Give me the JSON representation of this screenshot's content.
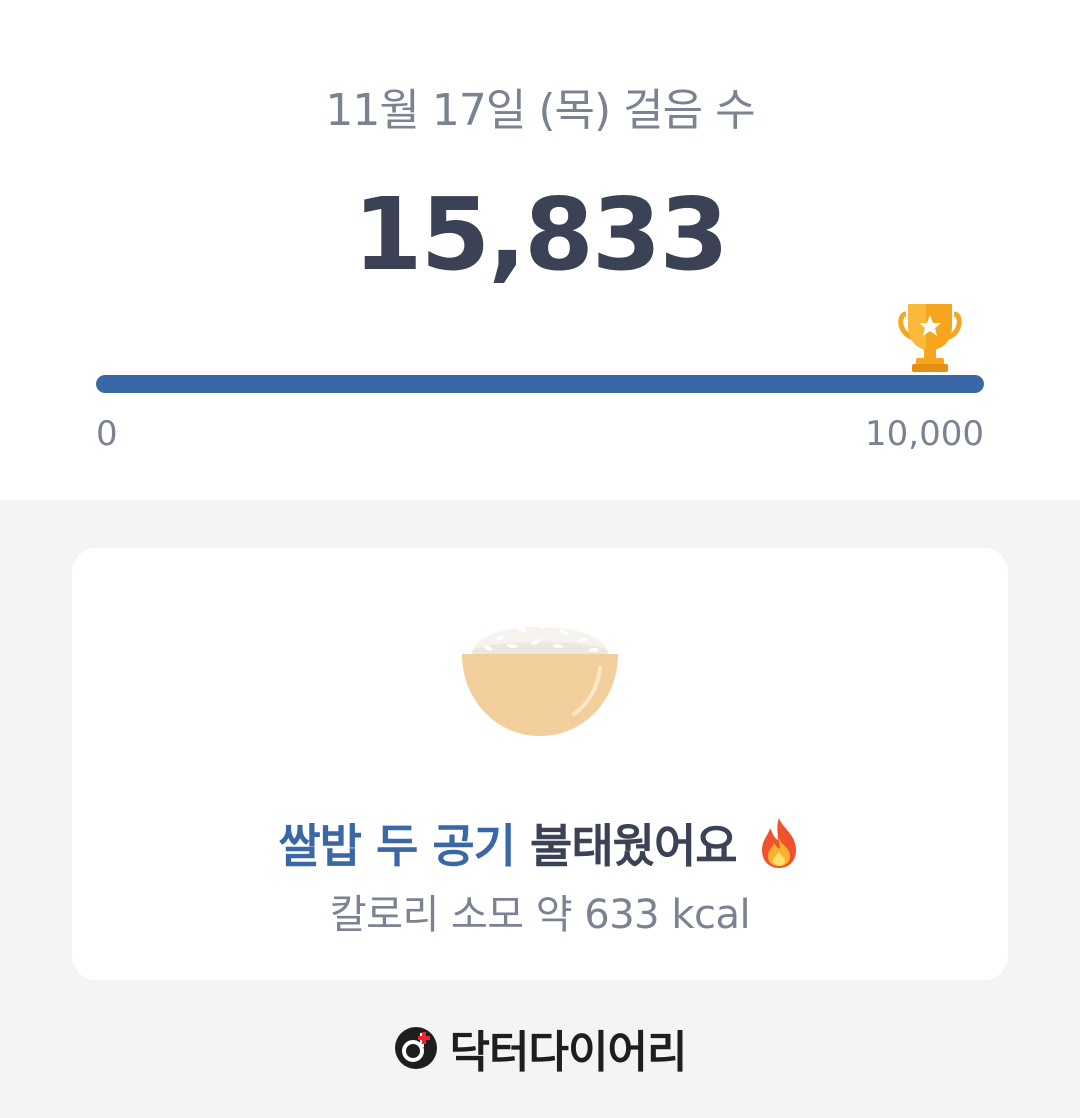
{
  "header": {
    "date_label": "11월 17일 (목) 걸음 수",
    "steps_count": "15,833"
  },
  "progress": {
    "min_label": "0",
    "max_label": "10,000",
    "current": 15833,
    "goal": 10000,
    "fill_fraction": 1.0,
    "goal_icon": "trophy-icon",
    "fill_color": "#3a67a6"
  },
  "summary_card": {
    "illustration_icon": "rice-bowl-icon",
    "headline_accent": "쌀밥 두 공기",
    "headline_rest": " 불태웠어요",
    "headline_icon": "fire-icon",
    "calorie_text": "칼로리 소모 약 633 kcal",
    "accent_color": "#3a67a6"
  },
  "footer": {
    "brand_name": "닥터다이어리",
    "brand_icon": "doctor-diary-logo-icon"
  }
}
